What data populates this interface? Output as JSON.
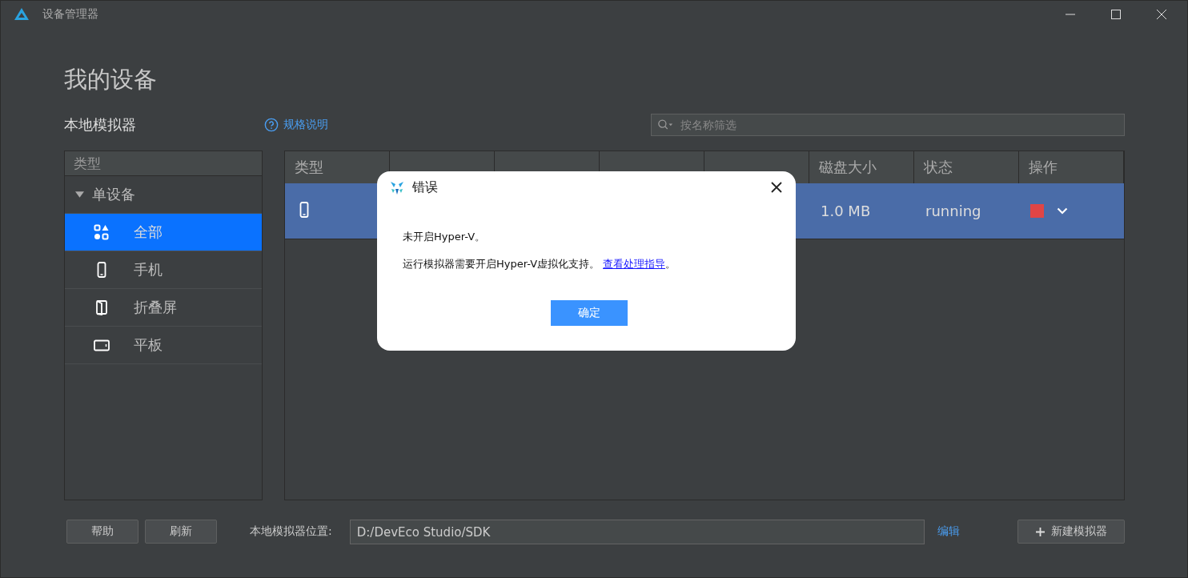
{
  "window": {
    "title": "设备管理器"
  },
  "page_title": "我的设备",
  "section": {
    "title": "本地模拟器",
    "help_link": "规格说明"
  },
  "search": {
    "placeholder": "按名称筛选"
  },
  "sidebar": {
    "header": "类型",
    "items": [
      {
        "label": "单设备",
        "kind": "group",
        "expanded": true,
        "children": [
          {
            "label": "全部",
            "kind": "all",
            "selected": true
          },
          {
            "label": "手机",
            "kind": "phone",
            "selected": false
          },
          {
            "label": "折叠屏",
            "kind": "foldable",
            "selected": false
          },
          {
            "label": "平板",
            "kind": "tablet",
            "selected": false
          }
        ]
      }
    ]
  },
  "table": {
    "columns": [
      "类型",
      "磁盘大小",
      "状态",
      "操作"
    ],
    "rows": [
      {
        "kind": "phone",
        "disk_size": "1.0 MB",
        "status": "running",
        "selected": true
      }
    ]
  },
  "footer": {
    "buttons": [
      "帮助",
      "刷新"
    ],
    "location_label": "本地模拟器位置:",
    "location_value": "D:/DevEco Studio/SDK",
    "edit_link": "编辑",
    "new_button": "新建模拟器"
  },
  "dialog": {
    "title": "错误",
    "message": "未开启Hyper-V。",
    "detail": "运行模拟器需要开启Hyper-V虚拟化支持。",
    "link": "查看处理指导",
    "after_link": "。",
    "ok_button": "确定"
  }
}
